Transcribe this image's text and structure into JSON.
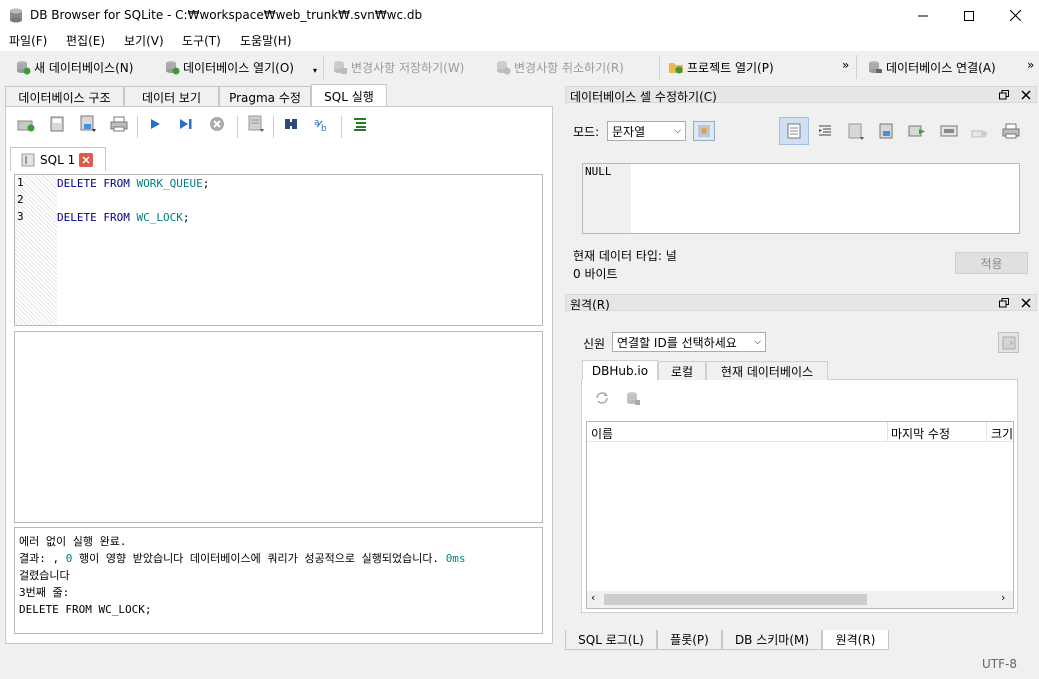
{
  "window": {
    "title": "DB Browser for SQLite - C:₩workspace₩web_trunk₩.svn₩wc.db"
  },
  "menu": [
    "파일(F)",
    "편집(E)",
    "보기(V)",
    "도구(T)",
    "도움말(H)"
  ],
  "toolbar": {
    "new_db": "새 데이터베이스(N)",
    "open_db": "데이터베이스 열기(O)",
    "write_changes": "변경사항 저장하기(W)",
    "revert_changes": "변경사항 취소하기(R)",
    "open_project": "프로젝트 열기(P)",
    "attach_db": "데이터베이스 연결(A)",
    "overflow": "»"
  },
  "tabs": [
    "데이터베이스 구조",
    "데이터 보기",
    "Pragma 수정",
    "SQL 실행"
  ],
  "sql_tab": {
    "label": "SQL 1"
  },
  "editor": {
    "lines": [
      {
        "num": "1",
        "kw": "DELETE FROM",
        "id": "WORK_QUEUE",
        "end": ";"
      },
      {
        "num": "2",
        "kw": "",
        "id": "",
        "end": ""
      },
      {
        "num": "3",
        "kw": "DELETE FROM",
        "id": "WC_LOCK",
        "end": ";"
      }
    ]
  },
  "message": {
    "line1": "에러 없이 실행 완료.",
    "line2a": "결과: , ",
    "line2num": "0",
    "line2b": " 행이 영향 받았습니다 데이터베이스에 쿼리가 성공적으로 실행되었습니다. ",
    "line2ms": "0ms",
    "line3": "걸렸습니다",
    "line4": "3번째 줄:",
    "line5": "DELETE FROM WC_LOCK;"
  },
  "edit_cell": {
    "header": "데이터베이스 셀 수정하기(C)",
    "mode_label": "모드:",
    "mode_value": "문자열",
    "value": "NULL",
    "type_text": "현재 데이터 타입: 널",
    "size_text": "0 바이트",
    "apply_label": "적용"
  },
  "remote": {
    "header": "원격(R)",
    "identity_label": "신원",
    "identity_value": "연결할 ID를 선택하세요",
    "tabs": [
      "DBHub.io",
      "로컬",
      "현재 데이터베이스"
    ],
    "columns": [
      "이름",
      "마지막 수정",
      "크기"
    ]
  },
  "bottom_tabs": [
    "SQL 로그(L)",
    "플롯(P)",
    "DB 스키마(M)",
    "원격(R)"
  ],
  "status": {
    "encoding": "UTF-8"
  },
  "colors": {
    "keyword": "#00008b",
    "identifier": "#008080",
    "accent": "#0078d7"
  }
}
